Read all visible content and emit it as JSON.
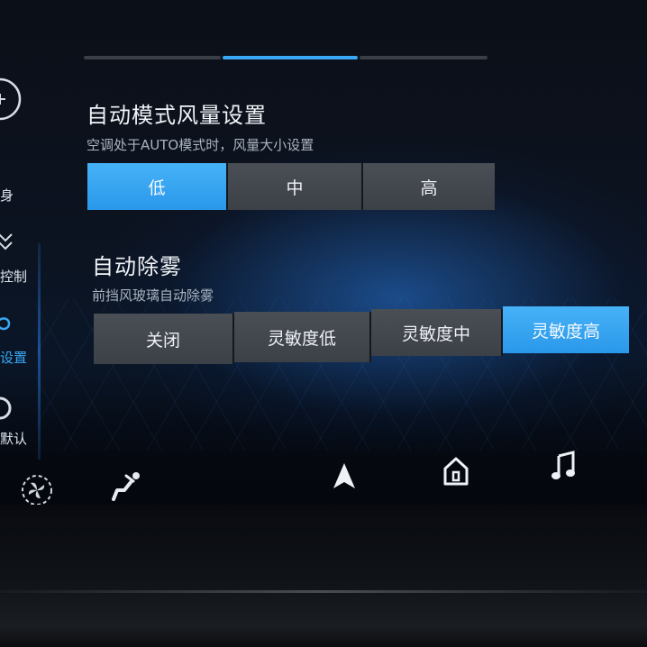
{
  "nav": {
    "items": [
      {
        "label": "身"
      },
      {
        "label": "控制"
      },
      {
        "label": "设置"
      },
      {
        "label": "默认"
      }
    ]
  },
  "auto_fan": {
    "title": "自动模式风量设置",
    "subtitle": "空调处于AUTO模式时，风量大小设置",
    "options": [
      "低",
      "中",
      "高"
    ],
    "selected": "低"
  },
  "defog": {
    "title": "自动除雾",
    "subtitle": "前挡风玻璃自动除雾",
    "options": [
      "关闭",
      "灵敏度低",
      "灵敏度中",
      "灵敏度高"
    ],
    "selected": "灵敏度高"
  },
  "bottom_bar": {
    "icons": [
      "fan-icon",
      "seat-airflow-icon",
      "navigation-arrow-icon",
      "home-icon",
      "music-note-icon"
    ]
  },
  "colors": {
    "accent": "#3aa7f2",
    "button": "#43474e"
  }
}
